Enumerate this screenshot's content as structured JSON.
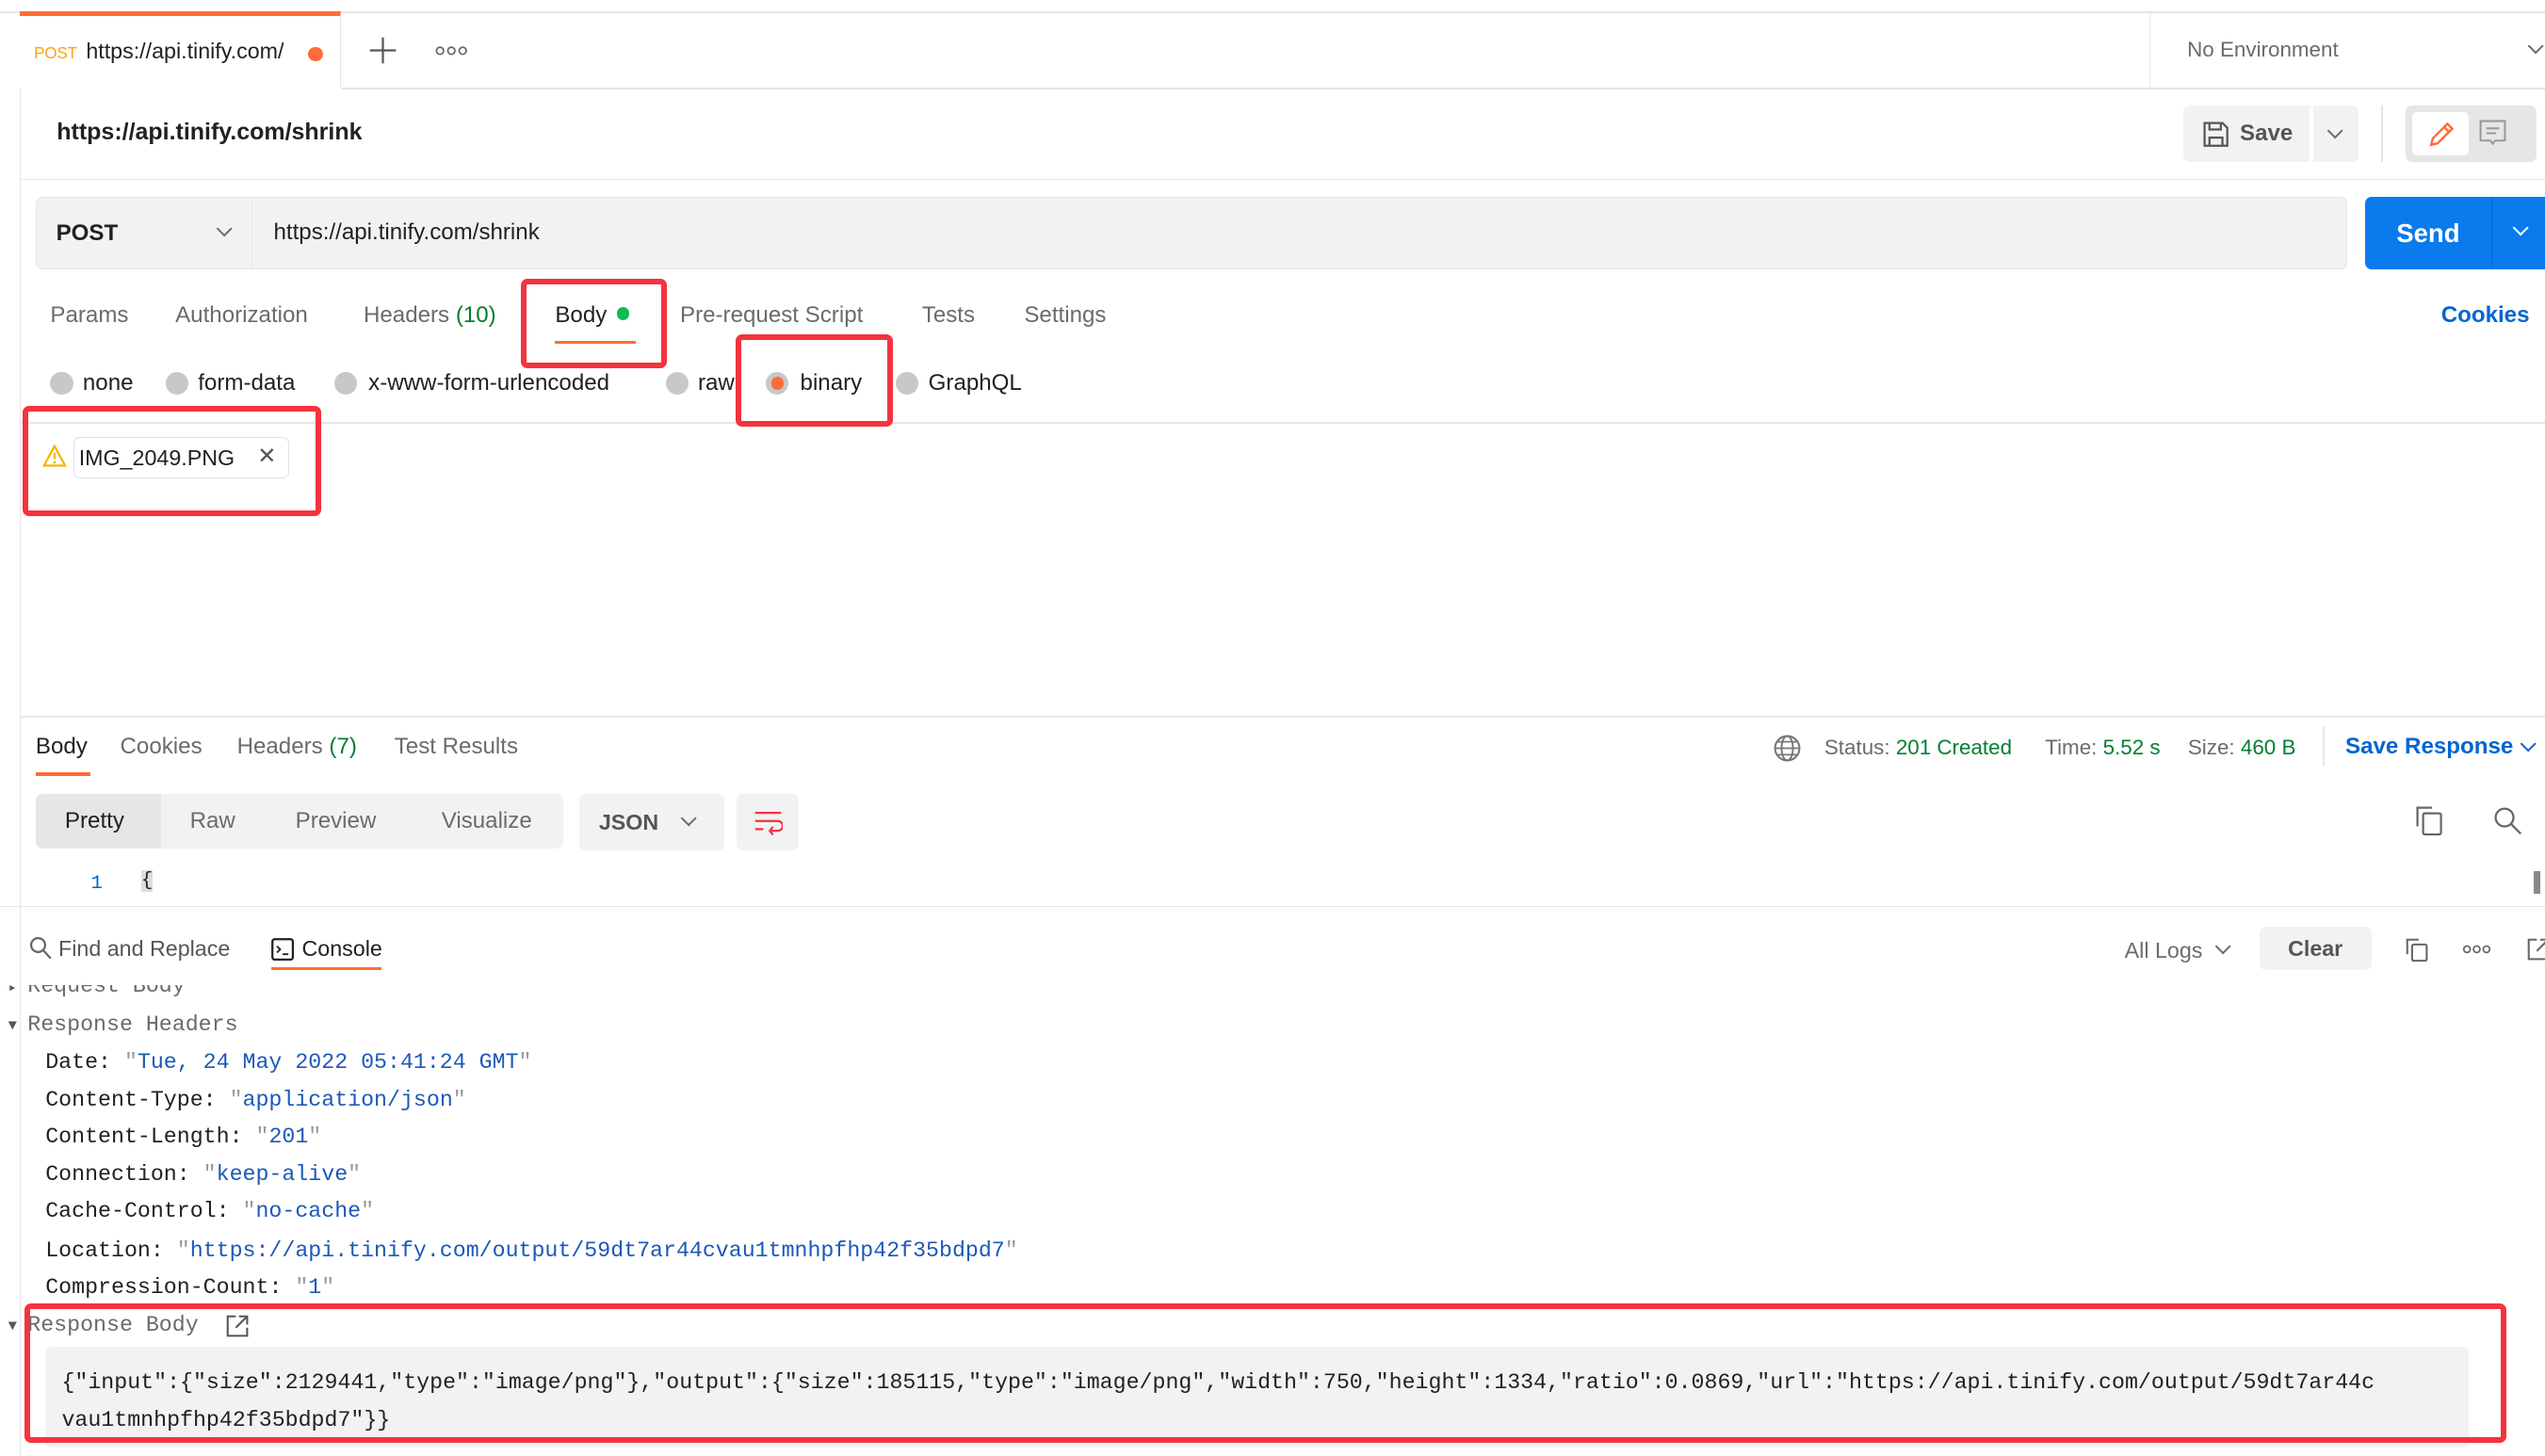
{
  "tabs": [
    {
      "method": "POST",
      "url": "https://api.tinify.com/",
      "unsaved": true
    }
  ],
  "tab_bar": {
    "new_tab_icon": "plus-icon",
    "more_icon": "more-horizontal-icon"
  },
  "environment": {
    "selected": "No Environment"
  },
  "request": {
    "title": "https://api.tinify.com/shrink",
    "save_label": "Save",
    "method": "POST",
    "url": "https://api.tinify.com/shrink",
    "send_label": "Send",
    "tabs": [
      {
        "label": "Params"
      },
      {
        "label": "Authorization"
      },
      {
        "label": "Headers",
        "count": "(10)"
      },
      {
        "label": "Body",
        "active": true,
        "indicator": "green-dot"
      },
      {
        "label": "Pre-request Script"
      },
      {
        "label": "Tests"
      },
      {
        "label": "Settings"
      }
    ],
    "cookies_label": "Cookies",
    "body_modes": [
      {
        "label": "none"
      },
      {
        "label": "form-data"
      },
      {
        "label": "x-www-form-urlencoded"
      },
      {
        "label": "raw"
      },
      {
        "label": "binary",
        "selected": true
      },
      {
        "label": "GraphQL"
      }
    ],
    "file": {
      "name": "IMG_2049.PNG",
      "warning": true
    }
  },
  "response": {
    "tabs": [
      {
        "label": "Body",
        "active": true
      },
      {
        "label": "Cookies"
      },
      {
        "label": "Headers",
        "count": "(7)"
      },
      {
        "label": "Test Results"
      }
    ],
    "status_label": "Status:",
    "status_value": "201 Created",
    "time_label": "Time:",
    "time_value": "5.52 s",
    "size_label": "Size:",
    "size_value": "460 B",
    "save_response_label": "Save Response",
    "view_modes": [
      "Pretty",
      "Raw",
      "Preview",
      "Visualize"
    ],
    "active_view": "Pretty",
    "format": "JSON",
    "line_number": "1",
    "first_line": "{"
  },
  "console": {
    "tabs": [
      {
        "label": "Find and Replace"
      },
      {
        "label": "Console",
        "active": true
      }
    ],
    "log_filter": "All Logs",
    "clear_label": "Clear",
    "request_body_section": "Request Body",
    "response_headers_section": "Response Headers",
    "headers": [
      {
        "key": "Date",
        "value": "Tue, 24 May 2022 05:41:24 GMT"
      },
      {
        "key": "Content-Type",
        "value": "application/json"
      },
      {
        "key": "Content-Length",
        "value": "201"
      },
      {
        "key": "Connection",
        "value": "keep-alive"
      },
      {
        "key": "Cache-Control",
        "value": "no-cache"
      },
      {
        "key": "Location",
        "value": "https://api.tinify.com/output/59dt7ar44cvau1tmnhpfhp42f35bdpd7"
      },
      {
        "key": "Compression-Count",
        "value": "1"
      }
    ],
    "response_body_section": "Response Body",
    "response_body_line1": "{\"input\":{\"size\":2129441,\"type\":\"image/png\"},\"output\":{\"size\":185115,\"type\":\"image/png\",\"width\":750,\"height\":1334,\"ratio\":0.0869,\"url\":\"https://api.tinify.com/output/59dt7ar44c",
    "response_body_line2": "vau1tmnhpfhp42f35bdpd7\"}}"
  },
  "colors": {
    "accent": "#FF6C37",
    "send_blue": "#097BED",
    "link_blue": "#0265D2",
    "success_green": "#007F31",
    "annotation_red": "#F4333F"
  }
}
